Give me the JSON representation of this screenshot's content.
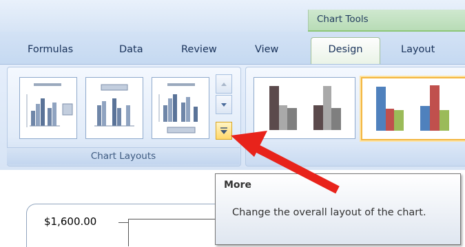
{
  "ribbon": {
    "contextual_header": "Chart Tools",
    "tabs": [
      {
        "label": "Formulas",
        "active": false
      },
      {
        "label": "Data",
        "active": false
      },
      {
        "label": "Review",
        "active": false
      },
      {
        "label": "View",
        "active": false
      },
      {
        "label": "Design",
        "active": true
      },
      {
        "label": "Layout",
        "active": false
      }
    ],
    "groups": {
      "chart_layouts": {
        "caption": "Chart Layouts",
        "gallery_items": [
          "layout-1",
          "layout-2",
          "layout-3"
        ],
        "more_button": "More"
      },
      "chart_styles": {
        "gallery_items": [
          "style-gray-bars",
          "style-colored-bars"
        ]
      }
    }
  },
  "tooltip": {
    "title": "More",
    "body": "Change the overall layout of the chart."
  },
  "sheet": {
    "axis_label": "$1,600.00"
  },
  "colors": {
    "annotation_arrow": "#e8231b",
    "contextual_tab_green": "#8cc677",
    "more_button_highlight": "#ffd86b",
    "bar_dark": "#5b4a4c",
    "bar_mid": "#a9a9a9",
    "bar_light": "#7f7f7f",
    "bar_blue": "#4f81bd",
    "bar_red": "#c0504d",
    "bar_green": "#9bbb59"
  }
}
